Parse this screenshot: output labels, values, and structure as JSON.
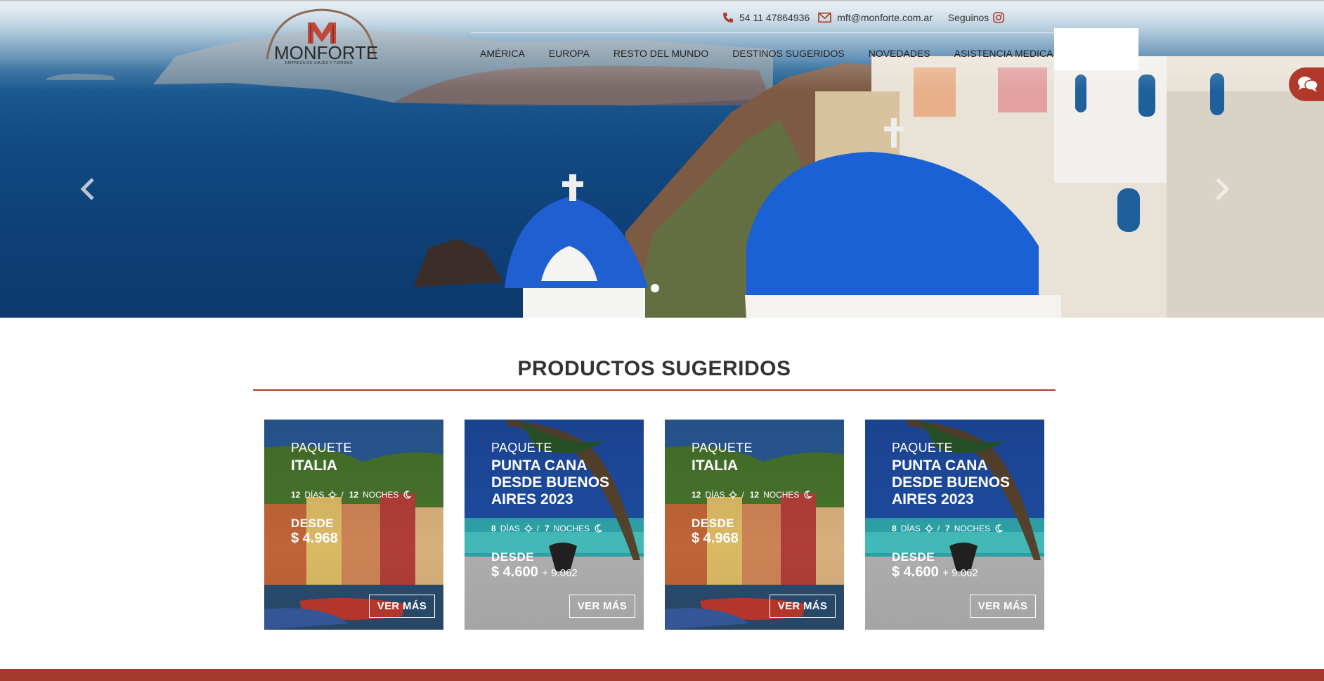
{
  "header": {
    "logo_word": "MONFORTE",
    "logo_tagline": "EMPRESA DE VIAJES Y TURISMO",
    "phone": "54 11 47864936",
    "email": "mft@monforte.com.ar",
    "follow_label": "Seguinos",
    "nav": [
      "AMÉRICA",
      "EUROPA",
      "RESTO DEL MUNDO",
      "DESTINOS SUGERIDOS",
      "NOVEDADES",
      "ASISTENCIA MEDICA"
    ]
  },
  "slider": {
    "slides_count": 1,
    "active_index": 0
  },
  "section": {
    "title": "PRODUCTOS SUGERIDOS"
  },
  "cards": [
    {
      "kind": "PAQUETE",
      "name": "ITALIA",
      "days": "12",
      "days_label": "DÍAS",
      "nights": "12",
      "nights_label": "NOCHES",
      "desde": "DESDE",
      "price": "$ 4.968",
      "price_extra": "",
      "button": "VER MÁS",
      "theme": "italy"
    },
    {
      "kind": "PAQUETE",
      "name": "PUNTA CANA DESDE BUENOS AIRES 2023",
      "days": "8",
      "days_label": "DÍAS",
      "nights": "7",
      "nights_label": "NOCHES",
      "desde": "DESDE",
      "price": "$ 4.600",
      "price_extra": "+ 9.062",
      "button": "VER MÁS",
      "theme": "beach"
    },
    {
      "kind": "PAQUETE",
      "name": "ITALIA",
      "days": "12",
      "days_label": "DÍAS",
      "nights": "12",
      "nights_label": "NOCHES",
      "desde": "DESDE",
      "price": "$ 4.968",
      "price_extra": "",
      "button": "VER MÁS",
      "theme": "italy"
    },
    {
      "kind": "PAQUETE",
      "name": "PUNTA CANA DESDE BUENOS AIRES 2023",
      "days": "8",
      "days_label": "DÍAS",
      "nights": "7",
      "nights_label": "NOCHES",
      "desde": "DESDE",
      "price": "$ 4.600",
      "price_extra": "+ 9.062",
      "button": "VER MÁS",
      "theme": "beach"
    }
  ],
  "colors": {
    "brand_red": "#b0392b",
    "text_dark": "#333333",
    "footer_red": "#a4382c"
  },
  "icons": {
    "phone": "phone-icon",
    "email": "envelope-icon",
    "instagram": "instagram-icon",
    "chat": "chat-icon",
    "prev": "chevron-left-icon",
    "next": "chevron-right-icon",
    "sun": "sun-icon",
    "moon": "moon-icon"
  }
}
